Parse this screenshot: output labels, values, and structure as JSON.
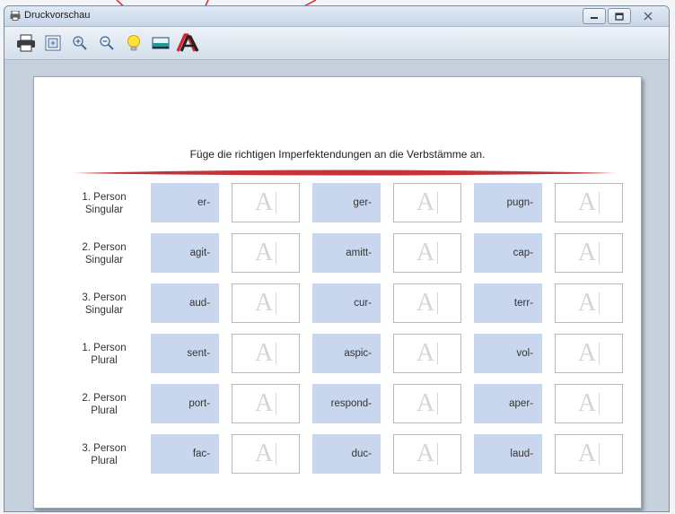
{
  "window": {
    "title": "Druckvorschau",
    "controls": [
      "minimize",
      "maximize",
      "close"
    ]
  },
  "toolbar": {
    "buttons": [
      {
        "name": "print-icon"
      },
      {
        "name": "fit-page-icon"
      },
      {
        "name": "zoom-in-icon"
      },
      {
        "name": "zoom-out-icon"
      },
      {
        "name": "hint-bulb-icon"
      },
      {
        "name": "image-icon"
      },
      {
        "name": "font-icon"
      }
    ]
  },
  "exercise": {
    "instruction": "Füge die richtigen Imperfektendungen an die Verbstämme an.",
    "placeholder_glyph": "A",
    "rows": [
      {
        "label1": "1. Person",
        "label2": "Singular",
        "stems": [
          "er-",
          "ger-",
          "pugn-"
        ]
      },
      {
        "label1": "2. Person",
        "label2": "Singular",
        "stems": [
          "agit-",
          "amitt-",
          "cap-"
        ]
      },
      {
        "label1": "3. Person",
        "label2": "Singular",
        "stems": [
          "aud-",
          "cur-",
          "terr-"
        ]
      },
      {
        "label1": "1. Person",
        "label2": "Plural",
        "stems": [
          "sent-",
          "aspic-",
          "vol-"
        ]
      },
      {
        "label1": "2. Person",
        "label2": "Plural",
        "stems": [
          "port-",
          "respond-",
          "aper-"
        ]
      },
      {
        "label1": "3. Person",
        "label2": "Plural",
        "stems": [
          "fac-",
          "duc-",
          "laud-"
        ]
      }
    ]
  },
  "colors": {
    "divider": "#c0343a",
    "stem_bg": "#c8d6ee",
    "annotation_arrow": "#e0202a"
  }
}
